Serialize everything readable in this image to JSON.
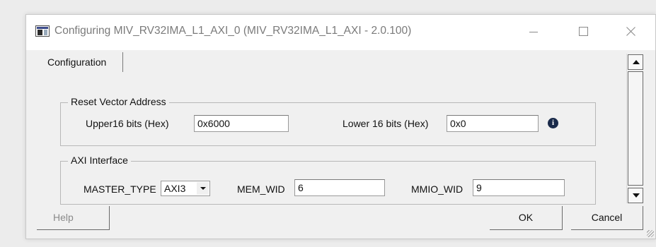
{
  "window": {
    "title": "Configuring MIV_RV32IMA_L1_AXI_0 (MIV_RV32IMA_L1_AXI - 2.0.100)",
    "icon": "app-window-icon",
    "controls": [
      "minimize-icon",
      "maximize-icon",
      "close-icon"
    ]
  },
  "tabs": [
    {
      "label": "Configuration",
      "selected": true
    }
  ],
  "reset_vector": {
    "group_label": "Reset Vector Address",
    "upper_label": "Upper16 bits (Hex)",
    "upper_value": "0x6000",
    "lower_label": "Lower 16 bits (Hex)",
    "lower_value": "0x0",
    "info_icon": "info-icon"
  },
  "axi": {
    "group_label": "AXI Interface",
    "master_type_label": "MASTER_TYPE",
    "master_type_value": "AXI3",
    "mem_wid_label": "MEM_WID",
    "mem_wid_value": "6",
    "mmio_wid_label": "MMIO_WID",
    "mmio_wid_value": "9"
  },
  "buttons": {
    "help": "Help",
    "ok": "OK",
    "cancel": "Cancel"
  },
  "colors": {
    "window_bg": "#f0f0f0",
    "titlebar_bg": "#ffffff",
    "title_text": "#7a7a7a",
    "disabled_text": "#8a8a8a"
  }
}
